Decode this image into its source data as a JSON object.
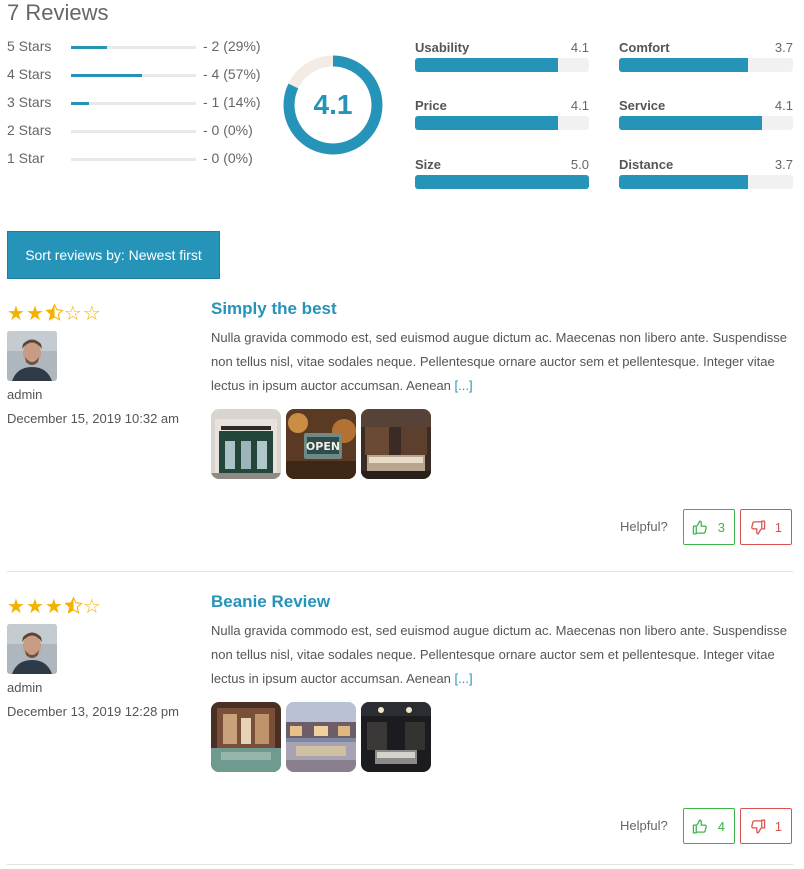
{
  "summary": {
    "title": "7 Reviews",
    "average": "4.1",
    "average_fraction": 0.82,
    "distribution": [
      {
        "label": "5 Stars",
        "count": "- 2 (29%)",
        "fraction": 0.29
      },
      {
        "label": "4 Stars",
        "count": "- 4 (57%)",
        "fraction": 0.57
      },
      {
        "label": "3 Stars",
        "count": "- 1 (14%)",
        "fraction": 0.14
      },
      {
        "label": "2 Stars",
        "count": "- 0 (0%)",
        "fraction": 0.0
      },
      {
        "label": "1 Star",
        "count": "- 0 (0%)",
        "fraction": 0.0
      }
    ],
    "criteria": [
      {
        "name": "Usability",
        "value": "4.1",
        "fraction": 0.82
      },
      {
        "name": "Comfort",
        "value": "3.7",
        "fraction": 0.74
      },
      {
        "name": "Price",
        "value": "4.1",
        "fraction": 0.82
      },
      {
        "name": "Service",
        "value": "4.1",
        "fraction": 0.82
      },
      {
        "name": "Size",
        "value": "5.0",
        "fraction": 1.0
      },
      {
        "name": "Distance",
        "value": "3.7",
        "fraction": 0.74
      }
    ]
  },
  "sort": {
    "label": "Sort reviews by: Newest first"
  },
  "reviews": [
    {
      "stars": 2.5,
      "title": "Simply the best",
      "text": "Nulla gravida commodo est, sed euismod augue dictum ac. Maecenas non libero ante. Suspendisse non tellus nisl, vitae sodales neque. Pellentesque ornare auctor sem et pellentesque. Integer vitae lectus in ipsum auctor accumsan. Aenean",
      "more": "[...]",
      "author": "admin",
      "date": "December 15, 2019 10:32 am",
      "helpful_label": "Helpful?",
      "up": "3",
      "down": "1"
    },
    {
      "stars": 3.5,
      "title": "Beanie Review",
      "text": "Nulla gravida commodo est, sed euismod augue dictum ac. Maecenas non libero ante. Suspendisse non tellus nisl, vitae sodales neque. Pellentesque ornare auctor sem et pellentesque. Integer vitae lectus in ipsum auctor accumsan. Aenean",
      "more": "[...]",
      "author": "admin",
      "date": "December 13, 2019 12:28 pm",
      "helpful_label": "Helpful?",
      "up": "4",
      "down": "1"
    }
  ],
  "colors": {
    "accent": "#2693b9",
    "star": "#f5b100",
    "up": "#3bb54a",
    "down": "#d9534f"
  }
}
